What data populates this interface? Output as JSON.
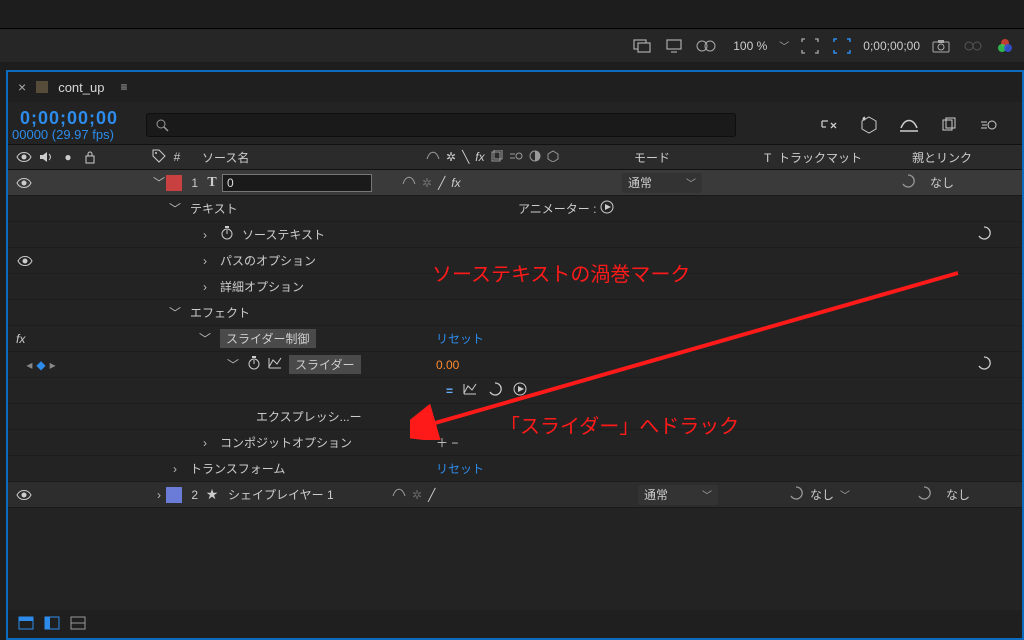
{
  "topbar": {
    "zoom": "100 %",
    "timecode": "0;00;00;00"
  },
  "panel": {
    "comp_name": "cont_up",
    "timecode": "0;00;00;00",
    "frame_info": "00000 (29.97 fps)"
  },
  "columns": {
    "source_name": "ソース名",
    "mode": "モード",
    "trkmat": "トラックマット",
    "parent": "親とリンク",
    "hash": "#",
    "t": "T"
  },
  "layers": [
    {
      "num": "1",
      "name": "0",
      "mode": "通常",
      "parent": "なし",
      "props": {
        "text": "テキスト",
        "animator": "アニメーター :",
        "source_text": "ソーステキスト",
        "path_opts": "パスのオプション",
        "more_opts": "詳細オプション",
        "effects": "エフェクト",
        "slider_ctrl": "スライダー制御",
        "reset": "リセット",
        "slider": "スライダー",
        "slider_val": "0.00",
        "expression": "エクスプレッシ...ー",
        "comp_opts": "コンポジットオプション",
        "plus_minus": "＋ −",
        "transform": "トランスフォーム"
      }
    },
    {
      "num": "2",
      "name": "シェイプレイヤー 1",
      "mode": "通常",
      "trkmat": "なし",
      "parent": "なし"
    }
  ],
  "annotations": {
    "a1": "ソーステキストの渦巻マーク",
    "a2": "「スライダー」へドラック"
  }
}
